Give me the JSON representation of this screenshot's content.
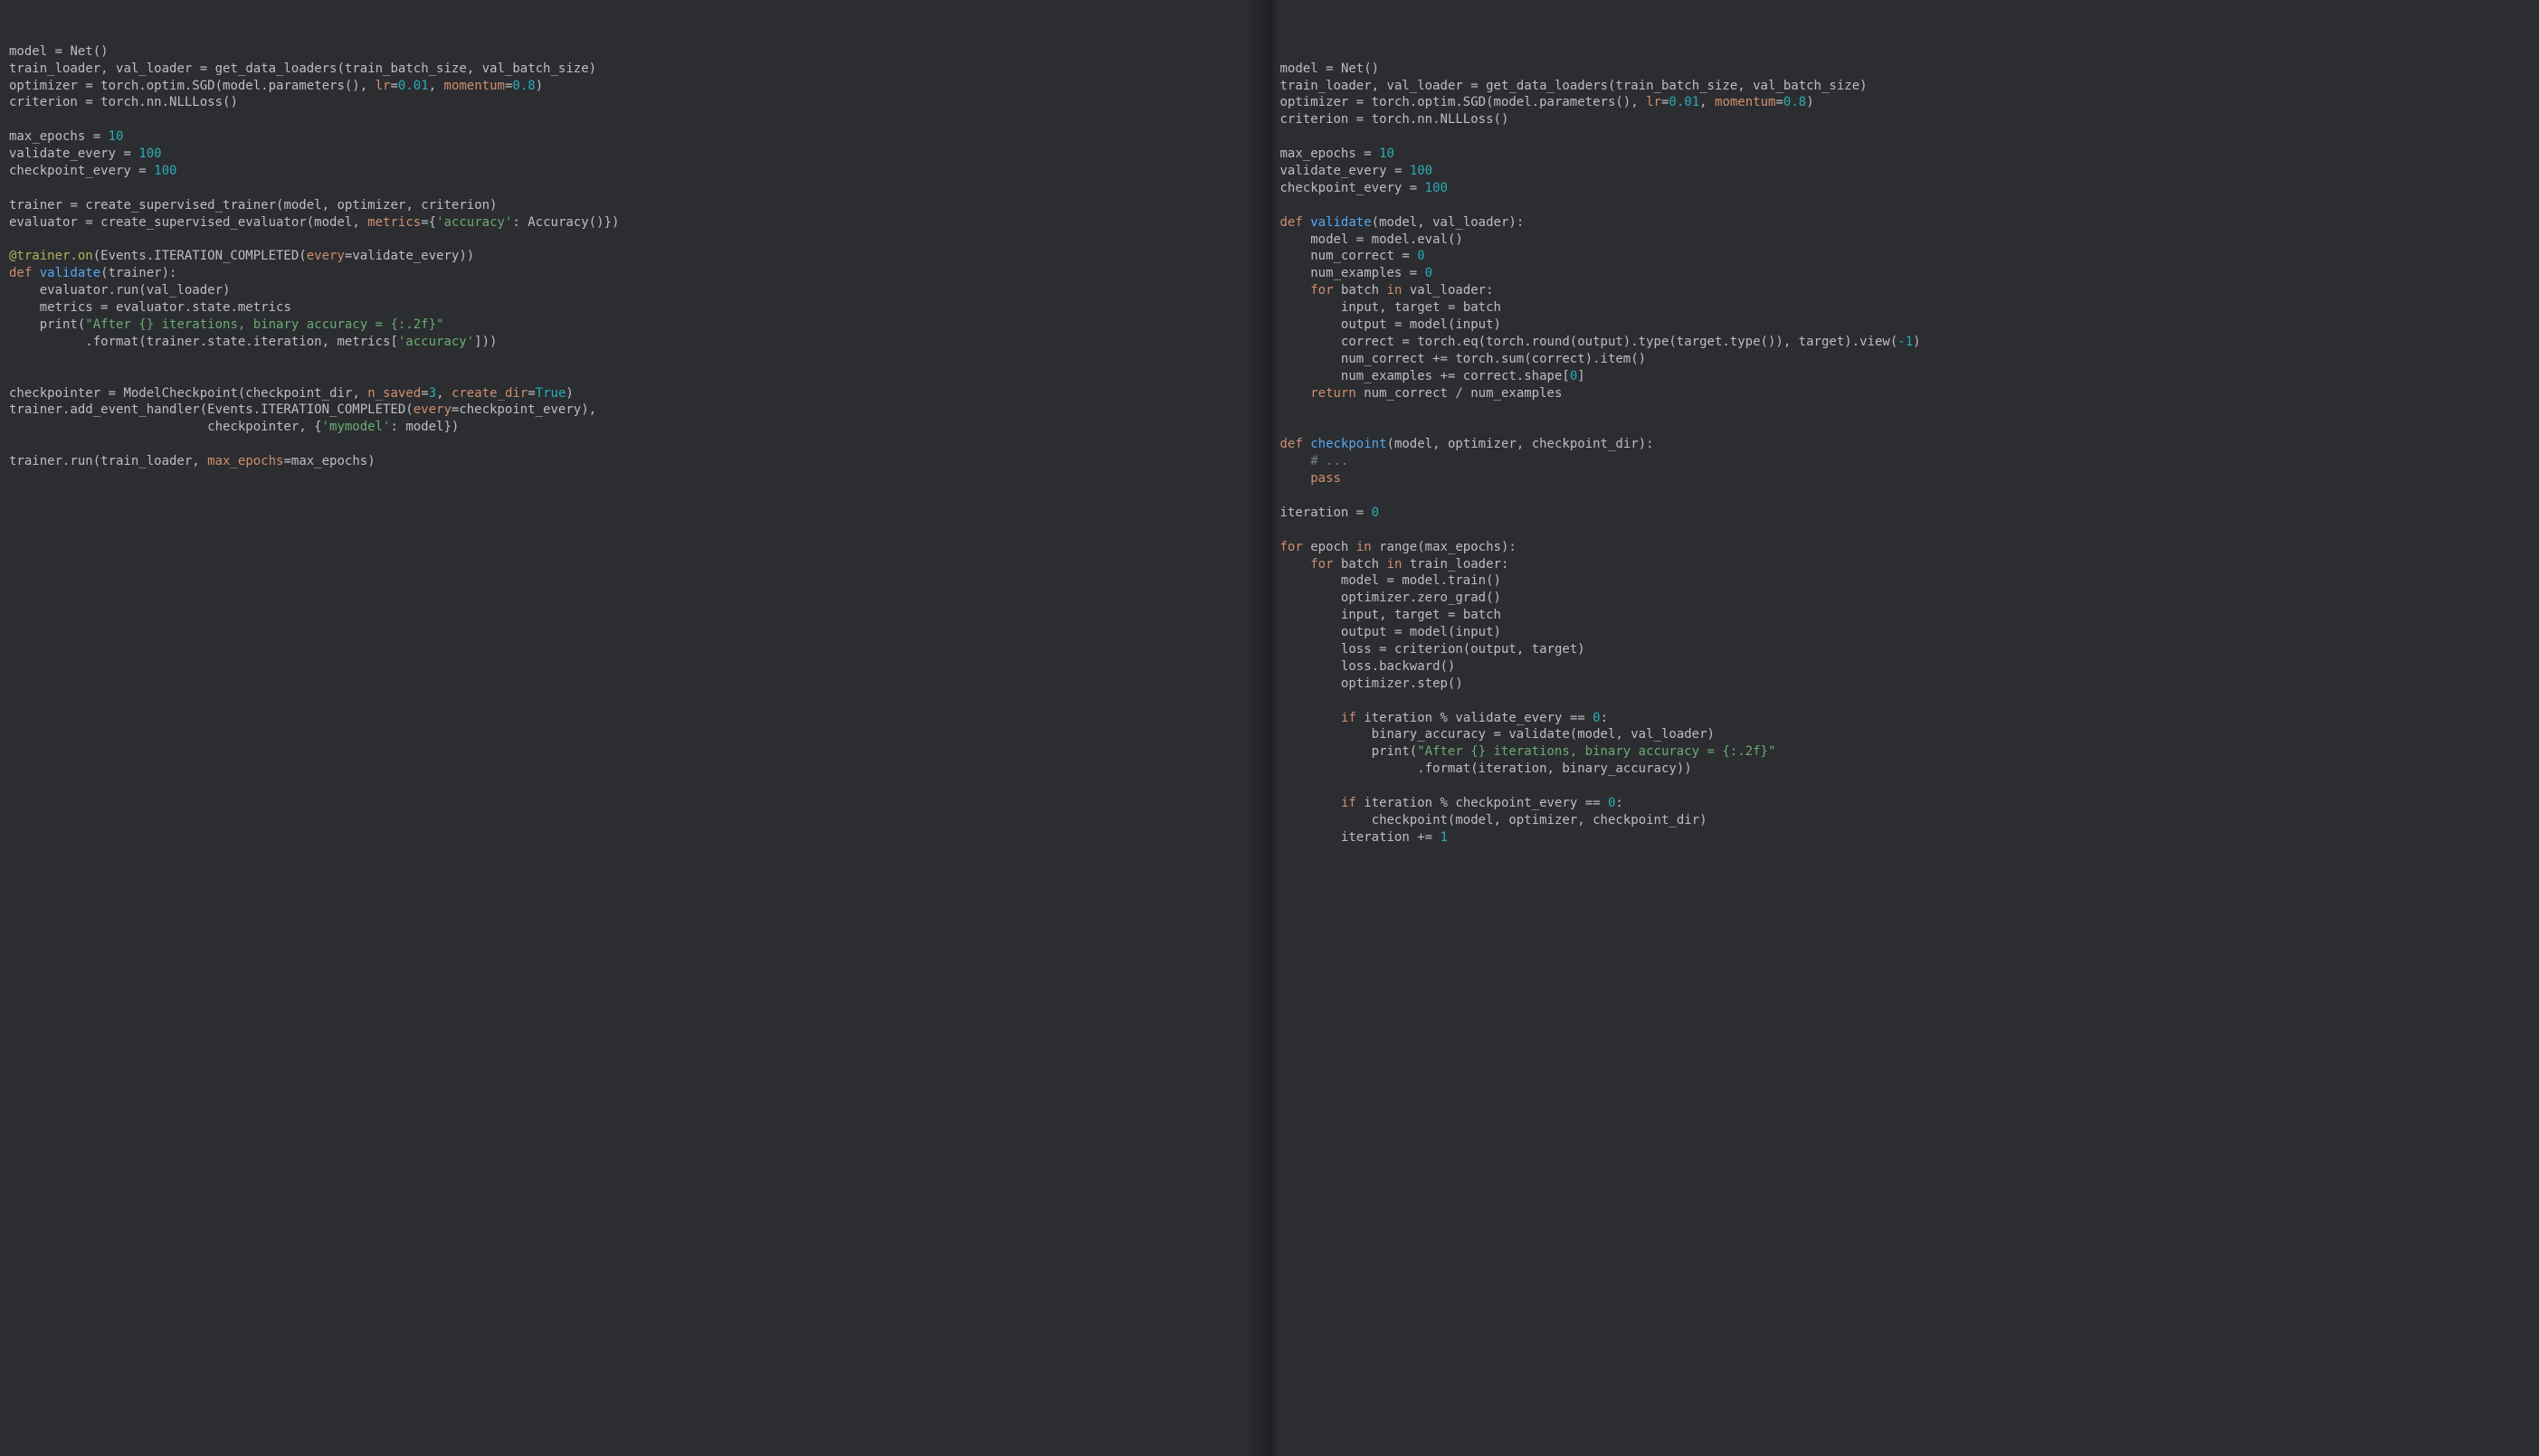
{
  "left": {
    "lines": [
      [
        [
          "model "
        ],
        [
          "="
        ],
        [
          " Net()"
        ]
      ],
      [
        [
          "train_loader"
        ],
        [
          ","
        ],
        [
          " val_loader "
        ],
        [
          "="
        ],
        [
          " get_data_loaders(train_batch_size"
        ],
        [
          ","
        ],
        [
          " val_batch_size)"
        ]
      ],
      [
        [
          "optimizer "
        ],
        [
          "="
        ],
        [
          " torch.optim.SGD(model.parameters()"
        ],
        [
          ","
        ],
        [
          " "
        ],
        [
          "lr",
          "arg"
        ],
        [
          "="
        ],
        [
          "0.01",
          "num"
        ],
        [
          ","
        ],
        [
          " "
        ],
        [
          "momentum",
          "arg"
        ],
        [
          "="
        ],
        [
          "0.8",
          "num"
        ],
        [
          ")"
        ]
      ],
      [
        [
          "criterion "
        ],
        [
          "="
        ],
        [
          " torch.nn.NLLLoss()"
        ]
      ],
      [
        [
          ""
        ]
      ],
      [
        [
          "max_epochs "
        ],
        [
          "="
        ],
        [
          " "
        ],
        [
          "10",
          "num"
        ]
      ],
      [
        [
          "validate_every "
        ],
        [
          "="
        ],
        [
          " "
        ],
        [
          "100",
          "num"
        ]
      ],
      [
        [
          "checkpoint_every "
        ],
        [
          "="
        ],
        [
          " "
        ],
        [
          "100",
          "num"
        ]
      ],
      [
        [
          ""
        ]
      ],
      [
        [
          "trainer "
        ],
        [
          "="
        ],
        [
          " create_supervised_trainer(model"
        ],
        [
          ","
        ],
        [
          " optimizer"
        ],
        [
          ","
        ],
        [
          " criterion)"
        ]
      ],
      [
        [
          "evaluator "
        ],
        [
          "="
        ],
        [
          " create_supervised_evaluator(model"
        ],
        [
          ","
        ],
        [
          " "
        ],
        [
          "metrics",
          "arg"
        ],
        [
          "="
        ],
        [
          "{"
        ],
        [
          "'accuracy'",
          "str"
        ],
        [
          ":"
        ],
        [
          " Accuracy()})"
        ]
      ],
      [
        [
          ""
        ]
      ],
      [
        [
          "@trainer.on",
          "dec"
        ],
        [
          "(Events.ITERATION_COMPLETED("
        ],
        [
          "every",
          "arg"
        ],
        [
          "="
        ],
        [
          "validate_every))"
        ]
      ],
      [
        [
          "def ",
          "kw"
        ],
        [
          "validate",
          "fn"
        ],
        [
          "(trainer):"
        ]
      ],
      [
        [
          "    evaluator.run(val_loader)"
        ]
      ],
      [
        [
          "    metrics "
        ],
        [
          "="
        ],
        [
          " evaluator.state.metrics"
        ]
      ],
      [
        [
          "    print("
        ],
        [
          "\"After {} iterations, binary accuracy = {:.2f}\"",
          "str"
        ]
      ],
      [
        [
          "          .format(trainer.state.iteration"
        ],
        [
          ","
        ],
        [
          " metrics["
        ],
        [
          "'accuracy'",
          "str"
        ],
        [
          "]))"
        ]
      ],
      [
        [
          ""
        ]
      ],
      [
        [
          ""
        ]
      ],
      [
        [
          "checkpointer "
        ],
        [
          "="
        ],
        [
          " ModelCheckpoint(checkpoint_dir"
        ],
        [
          ","
        ],
        [
          " "
        ],
        [
          "n_saved",
          "arg"
        ],
        [
          "="
        ],
        [
          "3",
          "num"
        ],
        [
          ","
        ],
        [
          " "
        ],
        [
          "create_dir",
          "arg"
        ],
        [
          "="
        ],
        [
          "True",
          "num"
        ],
        [
          ")"
        ]
      ],
      [
        [
          "trainer.add_event_handler(Events.ITERATION_COMPLETED("
        ],
        [
          "every",
          "arg"
        ],
        [
          "="
        ],
        [
          "checkpoint_every)"
        ],
        [
          ","
        ]
      ],
      [
        [
          "                          checkpointer"
        ],
        [
          ","
        ],
        [
          " {"
        ],
        [
          "'mymodel'",
          "str"
        ],
        [
          ":"
        ],
        [
          " model})"
        ]
      ],
      [
        [
          ""
        ]
      ],
      [
        [
          "trainer.run(train_loader"
        ],
        [
          ","
        ],
        [
          " "
        ],
        [
          "max_epochs",
          "arg"
        ],
        [
          "="
        ],
        [
          "max_epochs)"
        ]
      ]
    ]
  },
  "right": {
    "lines": [
      [
        [
          "model "
        ],
        [
          "="
        ],
        [
          " Net()"
        ]
      ],
      [
        [
          "train_loader"
        ],
        [
          ","
        ],
        [
          " val_loader "
        ],
        [
          "="
        ],
        [
          " get_data_loaders(train_batch_size"
        ],
        [
          ","
        ],
        [
          " val_batch_size)"
        ]
      ],
      [
        [
          "optimizer "
        ],
        [
          "="
        ],
        [
          " torch.optim.SGD(model.parameters()"
        ],
        [
          ","
        ],
        [
          " "
        ],
        [
          "lr",
          "arg"
        ],
        [
          "="
        ],
        [
          "0.01",
          "num"
        ],
        [
          ","
        ],
        [
          " "
        ],
        [
          "momentum",
          "arg"
        ],
        [
          "="
        ],
        [
          "0.8",
          "num"
        ],
        [
          ")"
        ]
      ],
      [
        [
          "criterion "
        ],
        [
          "="
        ],
        [
          " torch.nn.NLLLoss()"
        ]
      ],
      [
        [
          ""
        ]
      ],
      [
        [
          "max_epochs "
        ],
        [
          "="
        ],
        [
          " "
        ],
        [
          "10",
          "num"
        ]
      ],
      [
        [
          "validate_every "
        ],
        [
          "="
        ],
        [
          " "
        ],
        [
          "100",
          "num"
        ]
      ],
      [
        [
          "checkpoint_every "
        ],
        [
          "="
        ],
        [
          " "
        ],
        [
          "100",
          "num"
        ]
      ],
      [
        [
          ""
        ]
      ],
      [
        [
          "def ",
          "kw"
        ],
        [
          "validate",
          "fn"
        ],
        [
          "(model"
        ],
        [
          ","
        ],
        [
          " val_loader):"
        ]
      ],
      [
        [
          "    model "
        ],
        [
          "="
        ],
        [
          " model.eval()"
        ]
      ],
      [
        [
          "    num_correct "
        ],
        [
          "="
        ],
        [
          " "
        ],
        [
          "0",
          "num"
        ]
      ],
      [
        [
          "    num_examples "
        ],
        [
          "="
        ],
        [
          " "
        ],
        [
          "0",
          "num"
        ]
      ],
      [
        [
          "    "
        ],
        [
          "for ",
          "kw"
        ],
        [
          "batch "
        ],
        [
          "in ",
          "kw"
        ],
        [
          "val_loader:"
        ]
      ],
      [
        [
          "        input"
        ],
        [
          ","
        ],
        [
          " target "
        ],
        [
          "="
        ],
        [
          " batch"
        ]
      ],
      [
        [
          "        output "
        ],
        [
          "="
        ],
        [
          " model(input)"
        ]
      ],
      [
        [
          "        correct "
        ],
        [
          "="
        ],
        [
          " torch.eq(torch.round(output).type(target.type())"
        ],
        [
          ","
        ],
        [
          " target).view("
        ],
        [
          "-1",
          "num"
        ],
        [
          ")"
        ]
      ],
      [
        [
          "        num_correct "
        ],
        [
          "+="
        ],
        [
          " torch.sum(correct).item()"
        ]
      ],
      [
        [
          "        num_examples "
        ],
        [
          "+="
        ],
        [
          " correct.shape["
        ],
        [
          "0",
          "num"
        ],
        [
          "]"
        ]
      ],
      [
        [
          "    "
        ],
        [
          "return ",
          "kw"
        ],
        [
          "num_correct "
        ],
        [
          "/"
        ],
        [
          " num_examples"
        ]
      ],
      [
        [
          ""
        ]
      ],
      [
        [
          ""
        ]
      ],
      [
        [
          "def ",
          "kw"
        ],
        [
          "checkpoint",
          "fn"
        ],
        [
          "(model"
        ],
        [
          ","
        ],
        [
          " optimizer"
        ],
        [
          ","
        ],
        [
          " checkpoint_dir):"
        ]
      ],
      [
        [
          "    "
        ],
        [
          "# ...",
          "cmt"
        ]
      ],
      [
        [
          "    "
        ],
        [
          "pass",
          "kw"
        ]
      ],
      [
        [
          ""
        ]
      ],
      [
        [
          "iteration "
        ],
        [
          "="
        ],
        [
          " "
        ],
        [
          "0",
          "num"
        ]
      ],
      [
        [
          ""
        ]
      ],
      [
        [
          "for ",
          "kw"
        ],
        [
          "epoch "
        ],
        [
          "in ",
          "kw"
        ],
        [
          "range(max_epochs):"
        ]
      ],
      [
        [
          "    "
        ],
        [
          "for ",
          "kw"
        ],
        [
          "batch "
        ],
        [
          "in ",
          "kw"
        ],
        [
          "train_loader:"
        ]
      ],
      [
        [
          "        model "
        ],
        [
          "="
        ],
        [
          " model.train()"
        ]
      ],
      [
        [
          "        optimizer.zero_grad()"
        ]
      ],
      [
        [
          "        input"
        ],
        [
          ","
        ],
        [
          " target "
        ],
        [
          "="
        ],
        [
          " batch"
        ]
      ],
      [
        [
          "        output "
        ],
        [
          "="
        ],
        [
          " model(input)"
        ]
      ],
      [
        [
          "        loss "
        ],
        [
          "="
        ],
        [
          " criterion(output"
        ],
        [
          ","
        ],
        [
          " target)"
        ]
      ],
      [
        [
          "        loss.backward()"
        ]
      ],
      [
        [
          "        optimizer.step()"
        ]
      ],
      [
        [
          ""
        ]
      ],
      [
        [
          "        "
        ],
        [
          "if ",
          "kw"
        ],
        [
          "iteration "
        ],
        [
          "%"
        ],
        [
          " validate_every "
        ],
        [
          "=="
        ],
        [
          " "
        ],
        [
          "0",
          "num"
        ],
        [
          ":"
        ]
      ],
      [
        [
          "            binary_accuracy "
        ],
        [
          "="
        ],
        [
          " validate(model"
        ],
        [
          ","
        ],
        [
          " val_loader)"
        ]
      ],
      [
        [
          "            print("
        ],
        [
          "\"After {} iterations, binary accuracy = {:.2f}\"",
          "str"
        ]
      ],
      [
        [
          "                  .format(iteration"
        ],
        [
          ","
        ],
        [
          " binary_accuracy))"
        ]
      ],
      [
        [
          ""
        ]
      ],
      [
        [
          "        "
        ],
        [
          "if ",
          "kw"
        ],
        [
          "iteration "
        ],
        [
          "%"
        ],
        [
          " checkpoint_every "
        ],
        [
          "=="
        ],
        [
          " "
        ],
        [
          "0",
          "num"
        ],
        [
          ":"
        ]
      ],
      [
        [
          "            checkpoint(model"
        ],
        [
          ","
        ],
        [
          " optimizer"
        ],
        [
          ","
        ],
        [
          " checkpoint_dir)"
        ]
      ],
      [
        [
          "        iteration "
        ],
        [
          "+="
        ],
        [
          " "
        ],
        [
          "1",
          "num"
        ]
      ]
    ]
  }
}
